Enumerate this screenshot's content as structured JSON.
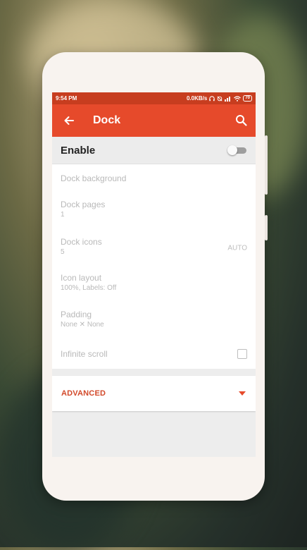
{
  "status_bar": {
    "time": "9:54 PM",
    "network_speed": "0.0KB/s",
    "battery": "70"
  },
  "app_bar": {
    "title": "Dock",
    "back_icon": "arrow-back-icon",
    "search_icon": "search-icon",
    "color": "#e64a2b"
  },
  "enable": {
    "label": "Enable",
    "enabled": false
  },
  "settings": [
    {
      "title": "Dock background",
      "subtitle": "",
      "value": ""
    },
    {
      "title": "Dock pages",
      "subtitle": "1",
      "value": ""
    },
    {
      "title": "Dock icons",
      "subtitle": "5",
      "value": "AUTO"
    },
    {
      "title": "Icon layout",
      "subtitle": "100%, Labels: Off",
      "value": ""
    },
    {
      "title": "Padding",
      "subtitle": "None ✕ None",
      "value": ""
    },
    {
      "title": "Infinite scroll",
      "subtitle": "",
      "checked": false
    }
  ],
  "advanced": {
    "label": "ADVANCED",
    "accent": "#d2492a"
  }
}
